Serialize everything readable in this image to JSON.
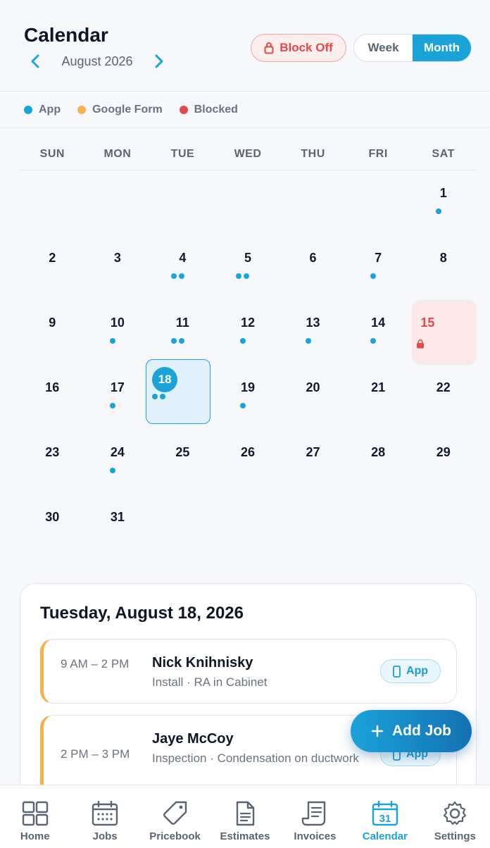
{
  "header": {
    "title": "Calendar",
    "month_label": "August 2026",
    "block_off_label": "Block Off",
    "view_week": "Week",
    "view_month": "Month"
  },
  "legend": [
    {
      "label": "App",
      "color": "#1aa3d9"
    },
    {
      "label": "Google Form",
      "color": "#f5b14c"
    },
    {
      "label": "Blocked",
      "color": "#e54848"
    }
  ],
  "weekdays": [
    "SUN",
    "MON",
    "TUE",
    "WED",
    "THU",
    "FRI",
    "SAT"
  ],
  "days": [
    {
      "n": "1",
      "dots": 1
    },
    {
      "n": "2",
      "dots": 0
    },
    {
      "n": "3",
      "dots": 0
    },
    {
      "n": "4",
      "dots": 2
    },
    {
      "n": "5",
      "dots": 2
    },
    {
      "n": "6",
      "dots": 0
    },
    {
      "n": "7",
      "dots": 1
    },
    {
      "n": "8",
      "dots": 0
    },
    {
      "n": "9",
      "dots": 0
    },
    {
      "n": "10",
      "dots": 1
    },
    {
      "n": "11",
      "dots": 2
    },
    {
      "n": "12",
      "dots": 1
    },
    {
      "n": "13",
      "dots": 1
    },
    {
      "n": "14",
      "dots": 1
    },
    {
      "n": "15",
      "dots": 0,
      "blocked": true
    },
    {
      "n": "16",
      "dots": 0
    },
    {
      "n": "17",
      "dots": 1
    },
    {
      "n": "18",
      "dots": 2,
      "selected": true
    },
    {
      "n": "19",
      "dots": 1
    },
    {
      "n": "20",
      "dots": 0
    },
    {
      "n": "21",
      "dots": 0
    },
    {
      "n": "22",
      "dots": 0
    },
    {
      "n": "23",
      "dots": 0
    },
    {
      "n": "24",
      "dots": 1
    },
    {
      "n": "25",
      "dots": 0
    },
    {
      "n": "26",
      "dots": 0
    },
    {
      "n": "27",
      "dots": 0
    },
    {
      "n": "28",
      "dots": 0
    },
    {
      "n": "29",
      "dots": 0
    },
    {
      "n": "30",
      "dots": 0
    },
    {
      "n": "31",
      "dots": 0
    }
  ],
  "first_weekday_index": 6,
  "day_panel": {
    "title": "Tuesday, August 18, 2026",
    "jobs": [
      {
        "time": "9 AM – 2 PM",
        "name": "Nick Knihnisky",
        "desc": "Install · RA in Cabinet",
        "source": "App"
      },
      {
        "time": "2 PM – 3 PM",
        "name": "Jaye McCoy",
        "desc": "Inspection · Condensation on ductwork",
        "source": "App"
      }
    ]
  },
  "fab_label": "Add Job",
  "bottom_nav": [
    {
      "label": "Home",
      "icon": "home-grid-icon"
    },
    {
      "label": "Jobs",
      "icon": "jobs-calendar-icon"
    },
    {
      "label": "Pricebook",
      "icon": "tag-icon"
    },
    {
      "label": "Estimates",
      "icon": "document-icon"
    },
    {
      "label": "Invoices",
      "icon": "receipt-icon"
    },
    {
      "label": "Calendar",
      "icon": "calendar-31-icon",
      "active": true,
      "badge": "31"
    },
    {
      "label": "Settings",
      "icon": "gear-icon"
    }
  ],
  "colors": {
    "accent": "#1aa3d9",
    "blocked": "#e54848",
    "google_form": "#f5b14c",
    "text_muted": "#5b6473"
  }
}
